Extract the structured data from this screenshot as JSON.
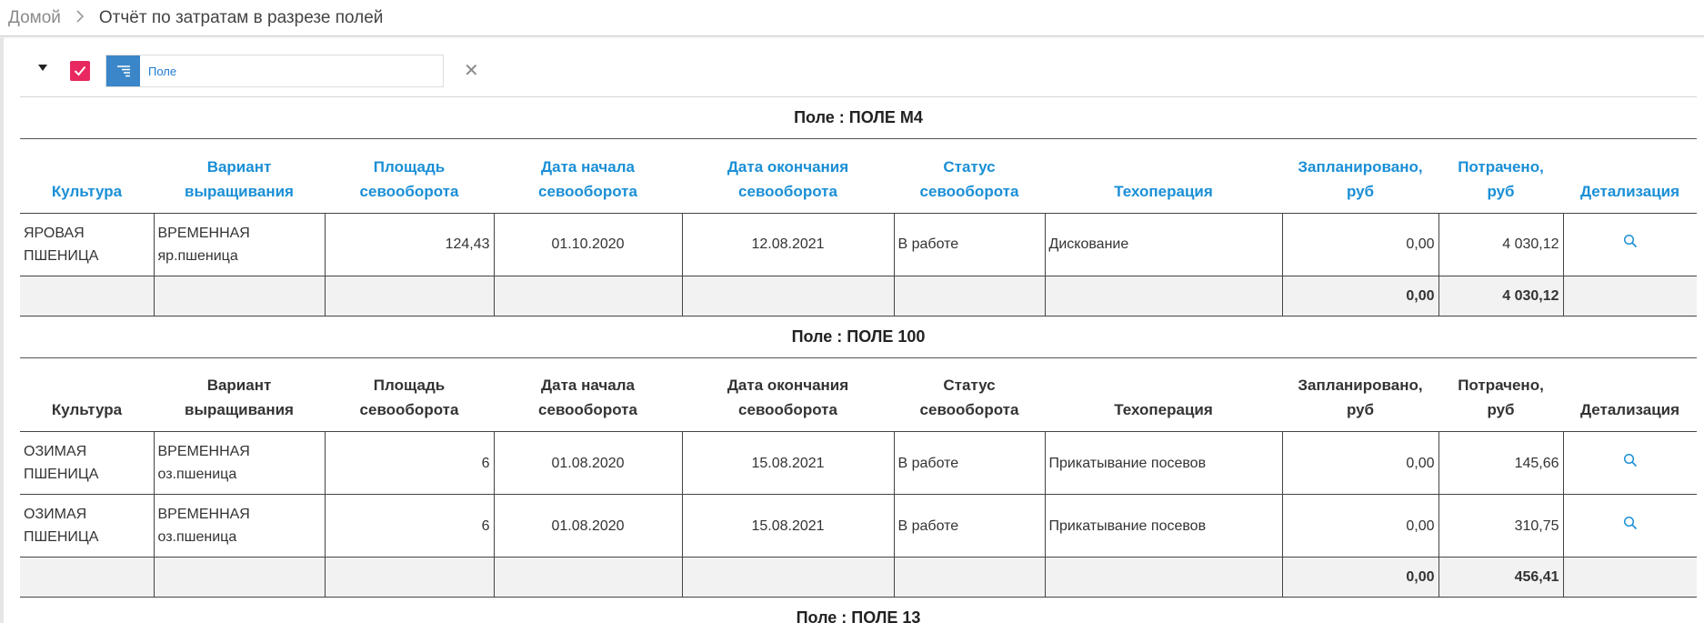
{
  "breadcrumb": {
    "home": "Домой",
    "current": "Отчёт по затратам в разрезе полей"
  },
  "toolbar": {
    "group_by_label": "Поле",
    "clear_icon": "close-icon"
  },
  "columns": [
    "Культура",
    "Вариант выращивания",
    "Площадь севооборота",
    "Дата начала севооборота",
    "Дата окончания севооборота",
    "Статус севооборота",
    "Техоперация",
    "Запланировано, руб",
    "Потрачено, руб",
    "Детализация"
  ],
  "groups": [
    {
      "title": "Поле : ПОЛЕ М4",
      "header_color": "#1a8fd6",
      "rows": [
        {
          "culture": "ЯРОВАЯ ПШЕНИЦА",
          "variant": "ВРЕМЕННАЯ яр.пшеница",
          "area": "124,43",
          "start": "01.10.2020",
          "end": "12.08.2021",
          "status": "В работе",
          "operation": "Дискование",
          "planned": "0,00",
          "spent": "4 030,12"
        }
      ],
      "total": {
        "planned": "0,00",
        "spent": "4 030,12"
      }
    },
    {
      "title": "Поле : ПОЛЕ 100",
      "header_color": "#333333",
      "rows": [
        {
          "culture": "ОЗИМАЯ ПШЕНИЦА",
          "variant": "ВРЕМЕННАЯ оз.пшеница",
          "area": "6",
          "start": "01.08.2020",
          "end": "15.08.2021",
          "status": "В работе",
          "operation": "Прикатывание посевов",
          "planned": "0,00",
          "spent": "145,66"
        },
        {
          "culture": "ОЗИМАЯ ПШЕНИЦА",
          "variant": "ВРЕМЕННАЯ оз.пшеница",
          "area": "6",
          "start": "01.08.2020",
          "end": "15.08.2021",
          "status": "В работе",
          "operation": "Прикатывание посевов",
          "planned": "0,00",
          "spent": "310,75"
        }
      ],
      "total": {
        "planned": "0,00",
        "spent": "456,41"
      }
    },
    {
      "title": "Поле : ПОЛЕ 13",
      "rows": []
    }
  ],
  "colors": {
    "accent": "#1a8fd6",
    "checkbox": "#e8285f",
    "group_button": "#3a86c8"
  }
}
